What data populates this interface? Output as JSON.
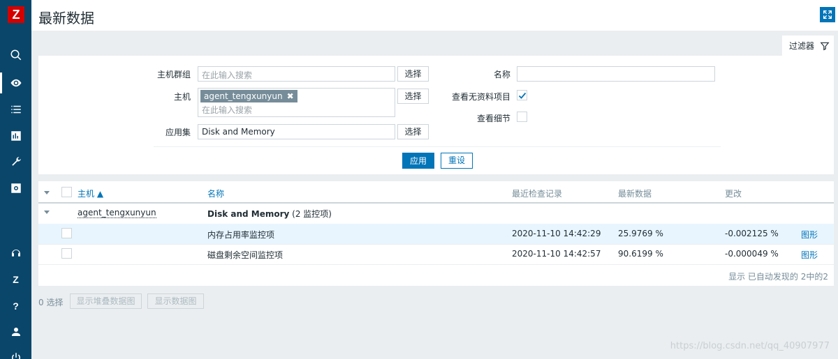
{
  "app": {
    "logo_letter": "Z"
  },
  "header": {
    "title": "最新数据"
  },
  "sidebar": {
    "items": [
      {
        "icon": "search-icon"
      },
      {
        "icon": "eye-icon",
        "active": true
      },
      {
        "icon": "list-icon"
      },
      {
        "icon": "chart-icon"
      },
      {
        "icon": "wrench-icon"
      },
      {
        "icon": "gear-icon"
      }
    ],
    "bottom": [
      {
        "icon": "headset-icon"
      },
      {
        "icon": "zabbix-icon",
        "label": "Z"
      },
      {
        "icon": "help-icon",
        "label": "?"
      },
      {
        "icon": "user-icon"
      },
      {
        "icon": "power-icon"
      }
    ]
  },
  "filter": {
    "tab_label": "过滤器",
    "host_group": {
      "label": "主机群组",
      "placeholder": "在此输入搜索",
      "button": "选择"
    },
    "host": {
      "label": "主机",
      "chip": "agent_tengxunyun",
      "chip_close": "✖",
      "placeholder": "在此输入搜索",
      "button": "选择"
    },
    "application": {
      "label": "应用集",
      "value": "Disk and Memory",
      "button": "选择"
    },
    "name": {
      "label": "名称",
      "value": ""
    },
    "show_without_data": {
      "label": "查看无资料项目",
      "checked": true
    },
    "show_details": {
      "label": "查看细节",
      "checked": false
    },
    "apply_label": "应用",
    "reset_label": "重设"
  },
  "table": {
    "headers": {
      "host": "主机 ▲",
      "name": "名称",
      "last_check": "最近检查记录",
      "last_value": "最新数据",
      "change": "更改"
    },
    "group": {
      "host": "agent_tengxunyun",
      "app_name": "Disk and Memory",
      "app_count": " (2 监控项)"
    },
    "rows": [
      {
        "name": "内存占用率监控项",
        "last_check": "2020-11-10 14:42:29",
        "last_value": "25.9769 %",
        "change": "-0.002125 %",
        "action": "图形"
      },
      {
        "name": "磁盘剩余空间监控项",
        "last_check": "2020-11-10 14:42:57",
        "last_value": "90.6199 %",
        "change": "-0.000049 %",
        "action": "图形"
      }
    ],
    "footer": "显示 已自动发现的 2中的2"
  },
  "bottom_actions": {
    "selected": "0 选择",
    "stacked_graph": "显示堆叠数据图",
    "graph": "显示数据图"
  },
  "watermark": "https://blog.csdn.net/qq_40907977",
  "colors": {
    "sidebar": "#0a466a",
    "accent": "#0275b8",
    "logo": "#d40000"
  }
}
